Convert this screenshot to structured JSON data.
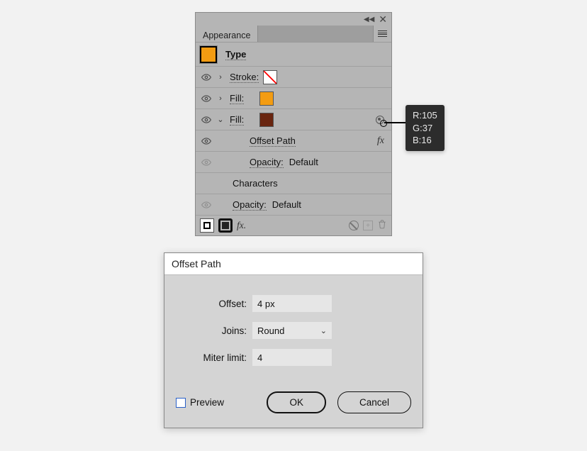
{
  "panel": {
    "tab_name": "Appearance",
    "type_label": "Type",
    "rows": {
      "stroke_label": "Stroke:",
      "fill_label": "Fill:",
      "offset_path_label": "Offset Path",
      "opacity_label": "Opacity:",
      "opacity_value": "Default",
      "characters_label": "Characters"
    }
  },
  "tooltip": {
    "r": "R:105",
    "g": "G:37",
    "b": "B:16"
  },
  "dialog": {
    "title": "Offset Path",
    "offset_label": "Offset:",
    "offset_value": "4 px",
    "joins_label": "Joins:",
    "joins_value": "Round",
    "miter_label": "Miter limit:",
    "miter_value": "4",
    "preview_label": "Preview",
    "ok_label": "OK",
    "cancel_label": "Cancel"
  },
  "colors": {
    "brown": "#692510",
    "orange": "#f39c12"
  }
}
